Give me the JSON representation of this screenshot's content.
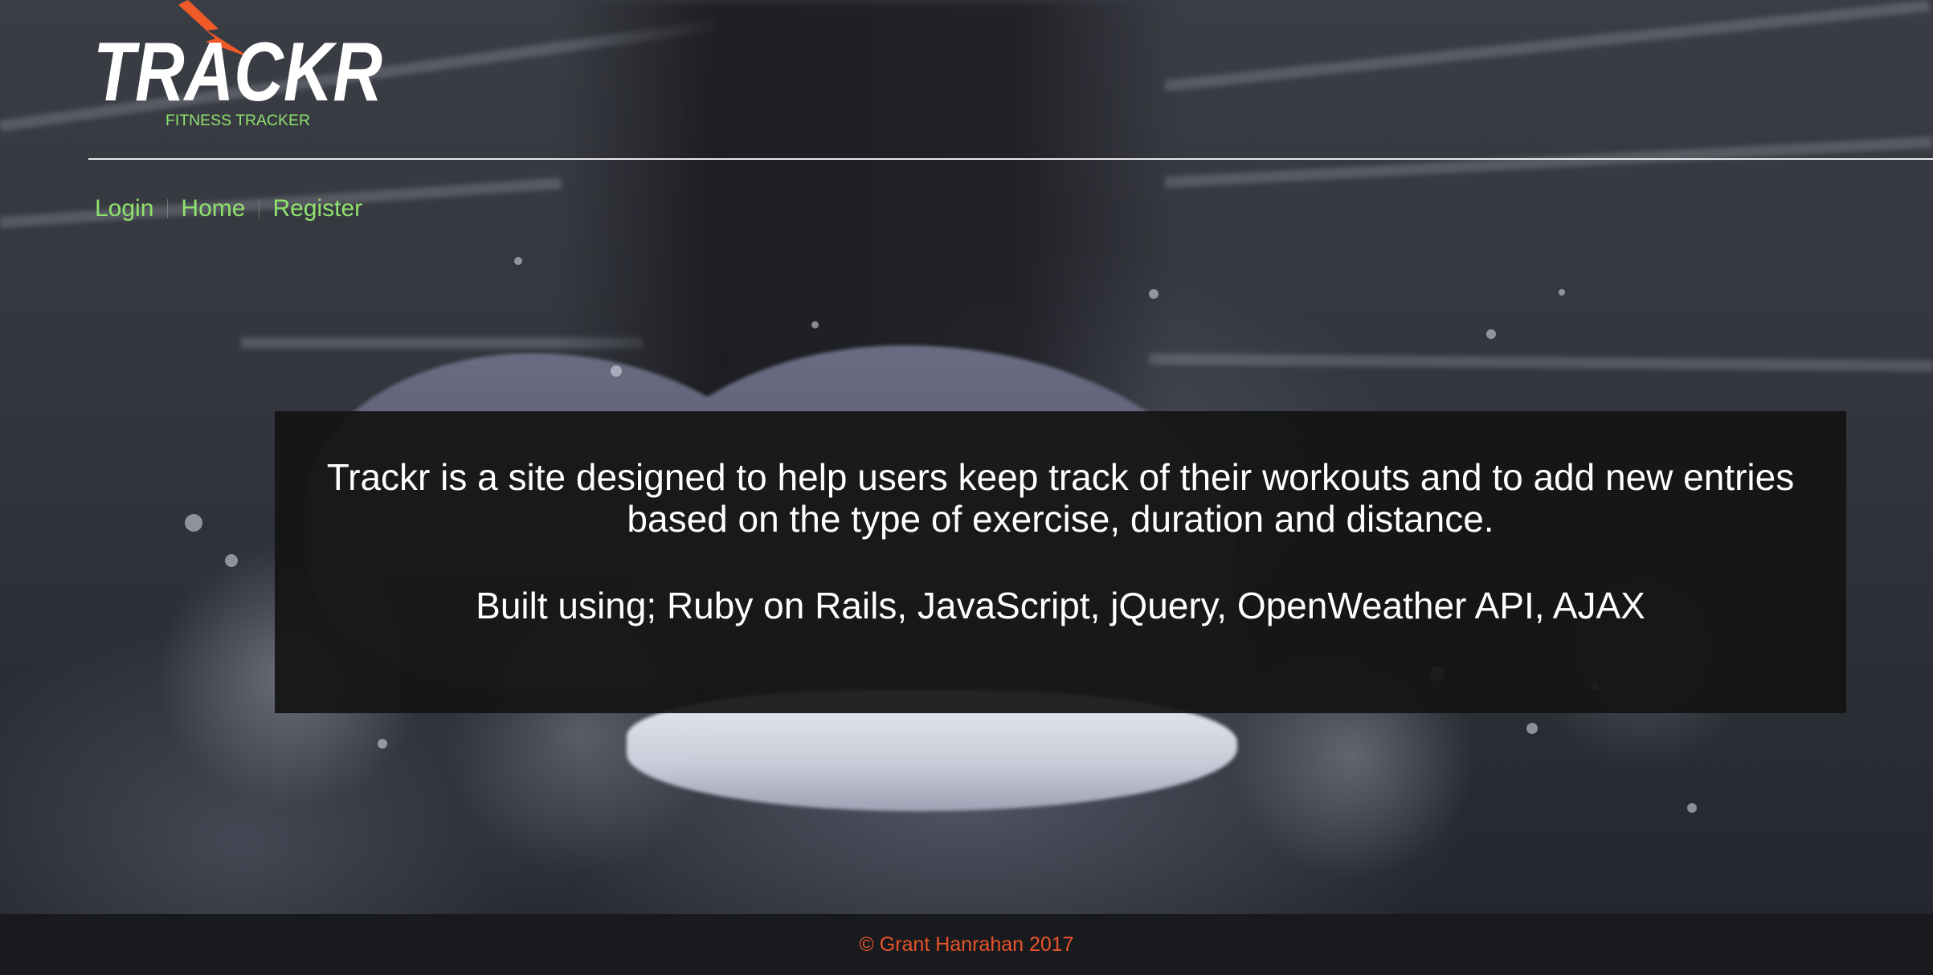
{
  "brand": {
    "name": "TRACKR",
    "tagline": "FITNESS TRACKER",
    "colors": {
      "logo_text": "#ffffff",
      "bolt": "#f05a28",
      "tagline": "#8fe26d"
    }
  },
  "nav": {
    "items": [
      {
        "label": "Login"
      },
      {
        "label": "Home"
      },
      {
        "label": "Register"
      }
    ],
    "link_color": "#8fe26d"
  },
  "info": {
    "description": "Trackr is a site designed to help users keep track of their workouts and to add new entries based on the type of exercise, duration and distance.",
    "built_with": "Built using; Ruby on Rails, JavaScript, jQuery, OpenWeather API, AJAX"
  },
  "footer": {
    "copyright": "© Grant Hanrahan 2017",
    "text_color": "#e8542a"
  },
  "background": {
    "description_icon": "running-shoe-splash-photo"
  }
}
